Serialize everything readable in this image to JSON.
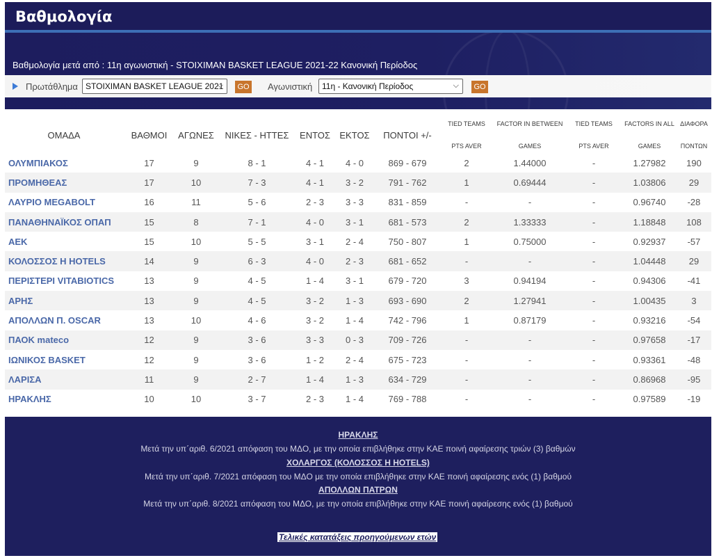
{
  "page_title": "Βαθμολογία",
  "subtitle": "Βαθμολογία μετά από : 11η αγωνιστική - STOIXIMAN BASKET LEAGUE 2021-22 Κανονική Περίοδος",
  "filters": {
    "championship_label": "Πρωτάθλημα",
    "championship_value": "STOIXIMAN BASKET LEAGUE 2021",
    "go_label": "GO",
    "round_label": "Αγωνιστική",
    "round_value": "11η - Κανονική Περίοδος"
  },
  "table": {
    "headers": {
      "team": "ΟΜΑΔΑ",
      "points": "ΒΑΘΜΟΙ",
      "games": "ΑΓΩΝΕΣ",
      "wl": "ΝΙΚΕΣ - ΗΤΤΕΣ",
      "home": "ΕΝΤΟΣ",
      "away": "ΕΚΤΟΣ",
      "score": "ΠΟΝΤΟΙ +/-",
      "tied1_a": "TIED TEAMS",
      "tied1_b": "PTS AVER",
      "factor1_a": "FACTOR IN BETWEEN",
      "factor1_b": "GAMES",
      "tied2_a": "TIED TEAMS",
      "tied2_b": "PTS AVER",
      "factor2_a": "FACTORS IN ALL",
      "factor2_b": "GAMES",
      "diff_a": "ΔΙΑΦΟΡΑ",
      "diff_b": "ΠΟΝΤΩΝ"
    },
    "rows": [
      {
        "team": "ΟΛΥΜΠΙΑΚΟΣ",
        "points": "17",
        "games": "9",
        "wl": "8 - 1",
        "home": "4 - 1",
        "away": "4 - 0",
        "score": "869 - 679",
        "tied1": "2",
        "factor1": "1.44000",
        "tied2": "-",
        "factor2": "1.27982",
        "diff": "190"
      },
      {
        "team": "ΠΡΟΜΗΘΕΑΣ",
        "points": "17",
        "games": "10",
        "wl": "7 - 3",
        "home": "4 - 1",
        "away": "3 - 2",
        "score": "791 - 762",
        "tied1": "1",
        "factor1": "0.69444",
        "tied2": "-",
        "factor2": "1.03806",
        "diff": "29"
      },
      {
        "team": "ΛΑΥΡΙΟ MEGABOLT",
        "points": "16",
        "games": "11",
        "wl": "5 - 6",
        "home": "2 - 3",
        "away": "3 - 3",
        "score": "831 - 859",
        "tied1": "-",
        "factor1": "-",
        "tied2": "-",
        "factor2": "0.96740",
        "diff": "-28"
      },
      {
        "team": "ΠΑΝΑΘΗΝΑΪΚΟΣ ΟΠΑΠ",
        "points": "15",
        "games": "8",
        "wl": "7 - 1",
        "home": "4 - 0",
        "away": "3 - 1",
        "score": "681 - 573",
        "tied1": "2",
        "factor1": "1.33333",
        "tied2": "-",
        "factor2": "1.18848",
        "diff": "108"
      },
      {
        "team": "ΑΕΚ",
        "points": "15",
        "games": "10",
        "wl": "5 - 5",
        "home": "3 - 1",
        "away": "2 - 4",
        "score": "750 - 807",
        "tied1": "1",
        "factor1": "0.75000",
        "tied2": "-",
        "factor2": "0.92937",
        "diff": "-57"
      },
      {
        "team": "ΚΟΛΟΣΣΟΣ H HOTELS",
        "points": "14",
        "games": "9",
        "wl": "6 - 3",
        "home": "4 - 0",
        "away": "2 - 3",
        "score": "681 - 652",
        "tied1": "-",
        "factor1": "-",
        "tied2": "-",
        "factor2": "1.04448",
        "diff": "29"
      },
      {
        "team": "ΠΕΡΙΣΤΕΡΙ VITABIOTICS",
        "points": "13",
        "games": "9",
        "wl": "4 - 5",
        "home": "1 - 4",
        "away": "3 - 1",
        "score": "679 - 720",
        "tied1": "3",
        "factor1": "0.94194",
        "tied2": "-",
        "factor2": "0.94306",
        "diff": "-41"
      },
      {
        "team": "ΑΡΗΣ",
        "points": "13",
        "games": "9",
        "wl": "4 - 5",
        "home": "3 - 2",
        "away": "1 - 3",
        "score": "693 - 690",
        "tied1": "2",
        "factor1": "1.27941",
        "tied2": "-",
        "factor2": "1.00435",
        "diff": "3"
      },
      {
        "team": "ΑΠΟΛΛΩΝ Π. OSCAR",
        "points": "13",
        "games": "10",
        "wl": "4 - 6",
        "home": "3 - 2",
        "away": "1 - 4",
        "score": "742 - 796",
        "tied1": "1",
        "factor1": "0.87179",
        "tied2": "-",
        "factor2": "0.93216",
        "diff": "-54"
      },
      {
        "team": "ΠΑΟΚ mateco",
        "points": "12",
        "games": "9",
        "wl": "3 - 6",
        "home": "3 - 3",
        "away": "0 - 3",
        "score": "709 - 726",
        "tied1": "-",
        "factor1": "-",
        "tied2": "-",
        "factor2": "0.97658",
        "diff": "-17"
      },
      {
        "team": "ΙΩΝΙΚΟΣ BASKET",
        "points": "12",
        "games": "9",
        "wl": "3 - 6",
        "home": "1 - 2",
        "away": "2 - 4",
        "score": "675 - 723",
        "tied1": "-",
        "factor1": "-",
        "tied2": "-",
        "factor2": "0.93361",
        "diff": "-48"
      },
      {
        "team": "ΛΑΡΙΣΑ",
        "points": "11",
        "games": "9",
        "wl": "2 - 7",
        "home": "1 - 4",
        "away": "1 - 3",
        "score": "634 - 729",
        "tied1": "-",
        "factor1": "-",
        "tied2": "-",
        "factor2": "0.86968",
        "diff": "-95"
      },
      {
        "team": "ΗΡΑΚΛΗΣ",
        "points": "10",
        "games": "10",
        "wl": "3 - 7",
        "home": "2 - 3",
        "away": "1 - 4",
        "score": "769 - 788",
        "tied1": "-",
        "factor1": "-",
        "tied2": "-",
        "factor2": "0.97589",
        "diff": "-19"
      }
    ]
  },
  "notes": [
    {
      "name": "ΗΡΑΚΛΗΣ",
      "text": "Μετά την υπ΄αριθ. 6/2021 απόφαση του ΜΔΟ, με την οποία επιβλήθηκε στην ΚΑΕ ποινή αφαίρεσης τριών (3) βαθμών"
    },
    {
      "name": "ΧΟΛΑΡΓΟΣ (ΚΟΛΟΣΣΟΣ H HOTELS)",
      "text": "Μετά την υπ΄αριθ. 7/2021 απόφαση του ΜΔΟ  με την οποία επιβλήθηκε στην ΚΑΕ ποινή αφαίρεσης ενός (1) βαθμού"
    },
    {
      "name": "ΑΠΟΛΛΩΝ ΠΑΤΡΩΝ",
      "text": "Μετά την υπ΄αριθ. 8/2021 απόφαση του ΜΔΟ, με την οποία επιβλήθηκε στην ΚΑΕ ποινή αφαίρεσης ενός (1) βαθμού"
    }
  ],
  "history_link": "Τελικές κατατάξεις προηγούμενων ετών"
}
